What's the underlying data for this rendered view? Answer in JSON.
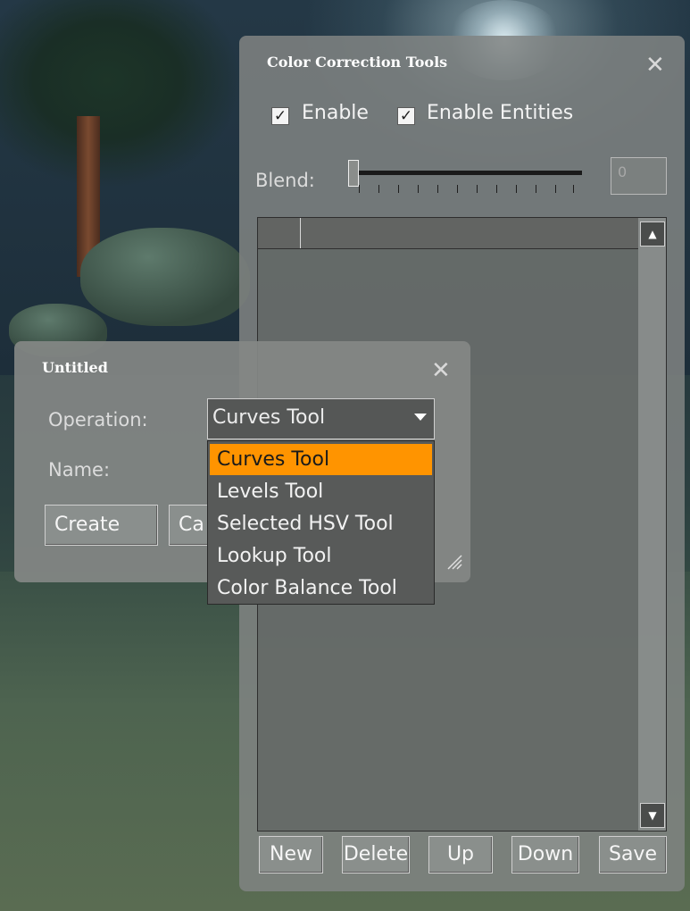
{
  "main_panel": {
    "title": "Color Correction Tools",
    "enable_label": "Enable",
    "enable_entities_label": "Enable Entities",
    "blend_label": "Blend:",
    "blend_value": "0",
    "buttons": {
      "new": "New",
      "delete": "Delete",
      "up": "Up",
      "down": "Down",
      "save": "Save"
    }
  },
  "dialog": {
    "title": "Untitled",
    "operation_label": "Operation:",
    "name_label": "Name:",
    "operation_selected": "Curves Tool",
    "create_label": "Create",
    "cancel_label_partial": "Ca",
    "options": [
      "Curves Tool",
      "Levels Tool",
      "Selected HSV Tool",
      "Lookup Tool",
      "Color Balance Tool"
    ]
  },
  "colors": {
    "highlight": "#ff9400",
    "panel": "#808482"
  },
  "icons": {
    "close": "close-icon",
    "check": "checkmark-icon",
    "dropdown": "chevron-down-icon",
    "scroll_up": "scroll-up-icon",
    "scroll_down": "scroll-down-icon",
    "resize": "resize-grip-icon"
  }
}
